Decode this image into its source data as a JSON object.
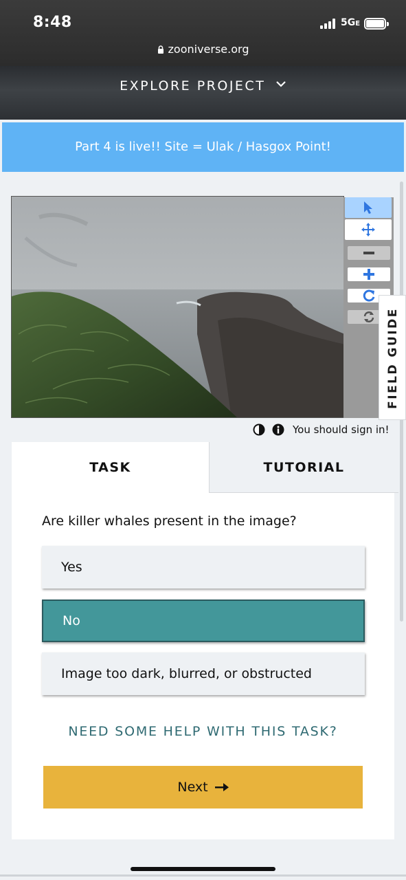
{
  "status_bar": {
    "time": "8:48",
    "network": "5G",
    "network_suffix": "E"
  },
  "browser": {
    "url": "zooniverse.org"
  },
  "header": {
    "explore_label": "EXPLORE PROJECT"
  },
  "banner": {
    "text": "Part 4 is live!! Site = Ulak / Hasgox Point!"
  },
  "subject_viewer": {
    "tools": [
      "pointer-icon",
      "move-icon",
      "zoom-out-icon",
      "zoom-in-icon",
      "rotate-icon",
      "reset-icon"
    ],
    "active_tool": "pointer-icon"
  },
  "field_guide": {
    "label": "FIELD GUIDE"
  },
  "meta": {
    "sign_in_text": "You should sign in!"
  },
  "tabs": {
    "task": "TASK",
    "tutorial": "TUTORIAL"
  },
  "task": {
    "question": "Are killer whales present in the image?",
    "answers": [
      "Yes",
      "No",
      "Image too dark, blurred, or obstructed"
    ],
    "selected": "No"
  },
  "help_link": "NEED SOME HELP WITH THIS TASK?",
  "next_button": "Next",
  "colors": {
    "banner": "#5fb3f5",
    "selected_answer": "#43979a",
    "next_button": "#e8b33c",
    "help_link": "#2f6a72"
  }
}
